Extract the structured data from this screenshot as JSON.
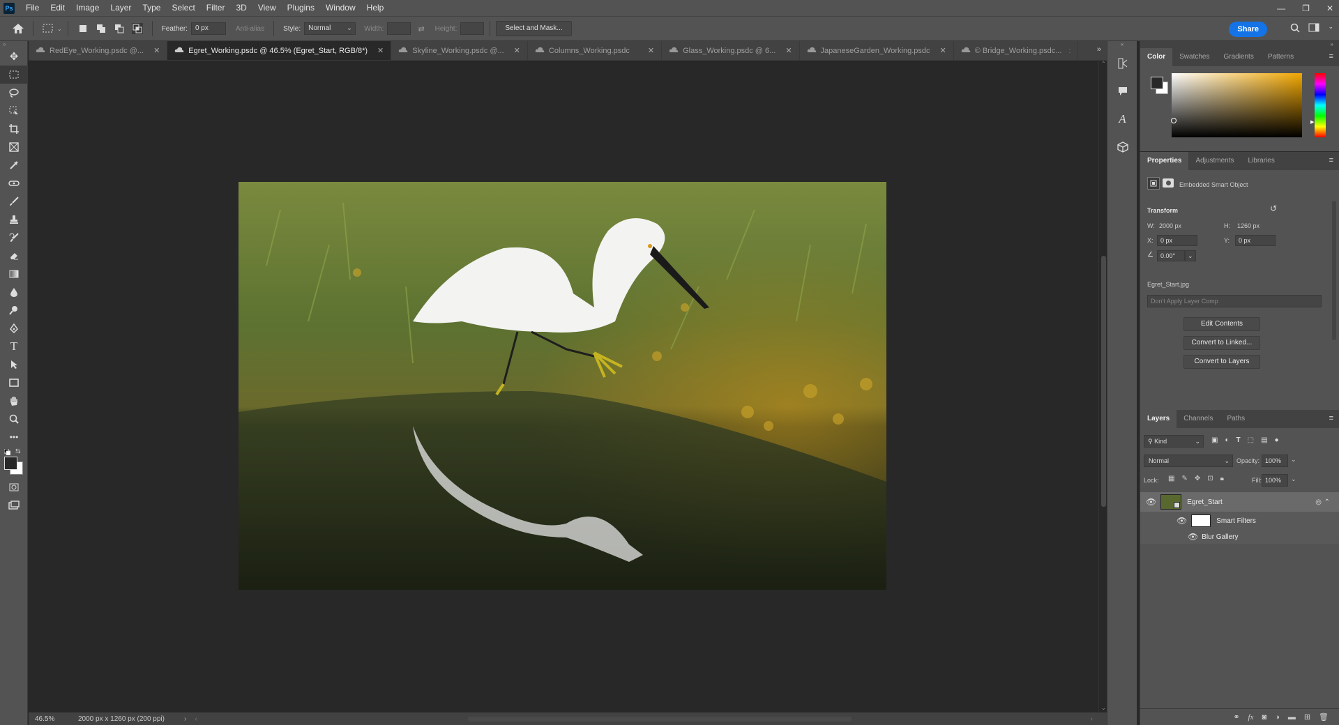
{
  "app": {
    "logo": "Ps"
  },
  "menubar": {
    "items": [
      "File",
      "Edit",
      "Image",
      "Layer",
      "Type",
      "Select",
      "Filter",
      "3D",
      "View",
      "Plugins",
      "Window",
      "Help"
    ]
  },
  "window_controls": {
    "minimize": "—",
    "restore": "❐",
    "close": "✕"
  },
  "options": {
    "feather_label": "Feather:",
    "feather_value": "0 px",
    "antialias_label": "Anti-alias",
    "style_label": "Style:",
    "style_value": "Normal",
    "width_label": "Width:",
    "height_label": "Height:",
    "select_mask_label": "Select and Mask...",
    "share_label": "Share"
  },
  "tabs": [
    {
      "label": "RedEye_Working.psdc @...",
      "active": false
    },
    {
      "label": "Egret_Working.psdc @ 46.5% (Egret_Start, RGB/8*)",
      "active": true
    },
    {
      "label": "Skyline_Working.psdc @...",
      "active": false
    },
    {
      "label": "Columns_Working.psdc",
      "active": false
    },
    {
      "label": "Glass_Working.psdc @ 6...",
      "active": false
    },
    {
      "label": "JapaneseGarden_Working.psdc",
      "active": false
    },
    {
      "label": "© Bridge_Working.psdc...",
      "active": false
    }
  ],
  "status": {
    "zoom": "46.5%",
    "doc_size": "2000 px x 1260 px (200 ppi)"
  },
  "color_panel": {
    "tabs": [
      "Color",
      "Swatches",
      "Gradients",
      "Patterns"
    ]
  },
  "properties_panel": {
    "tabs": [
      "Properties",
      "Adjustments",
      "Libraries"
    ],
    "type_label": "Embedded Smart Object",
    "transform_label": "Transform",
    "w_label": "W:",
    "w_value": "2000 px",
    "h_label": "H:",
    "h_value": "1260 px",
    "x_label": "X:",
    "x_value": "0 px",
    "y_label": "Y:",
    "y_value": "0 px",
    "angle_value": "0.00°",
    "filename": "Egret_Start.jpg",
    "layer_comp_placeholder": "Don't Apply Layer Comp",
    "edit_contents": "Edit Contents",
    "convert_linked": "Convert to Linked...",
    "convert_layers": "Convert to Layers"
  },
  "layers_panel": {
    "tabs": [
      "Layers",
      "Channels",
      "Paths"
    ],
    "kind_label": "Kind",
    "blend_mode": "Normal",
    "opacity_label": "Opacity:",
    "opacity_value": "100%",
    "lock_label": "Lock:",
    "fill_label": "Fill:",
    "fill_value": "100%",
    "layers": [
      {
        "name": "Egret_Start"
      },
      {
        "name": "Smart Filters"
      },
      {
        "name": "Blur Gallery"
      }
    ]
  },
  "colors": {
    "accent": "#1473e6",
    "ui_bg": "#535353",
    "canvas_bg": "#282828"
  }
}
